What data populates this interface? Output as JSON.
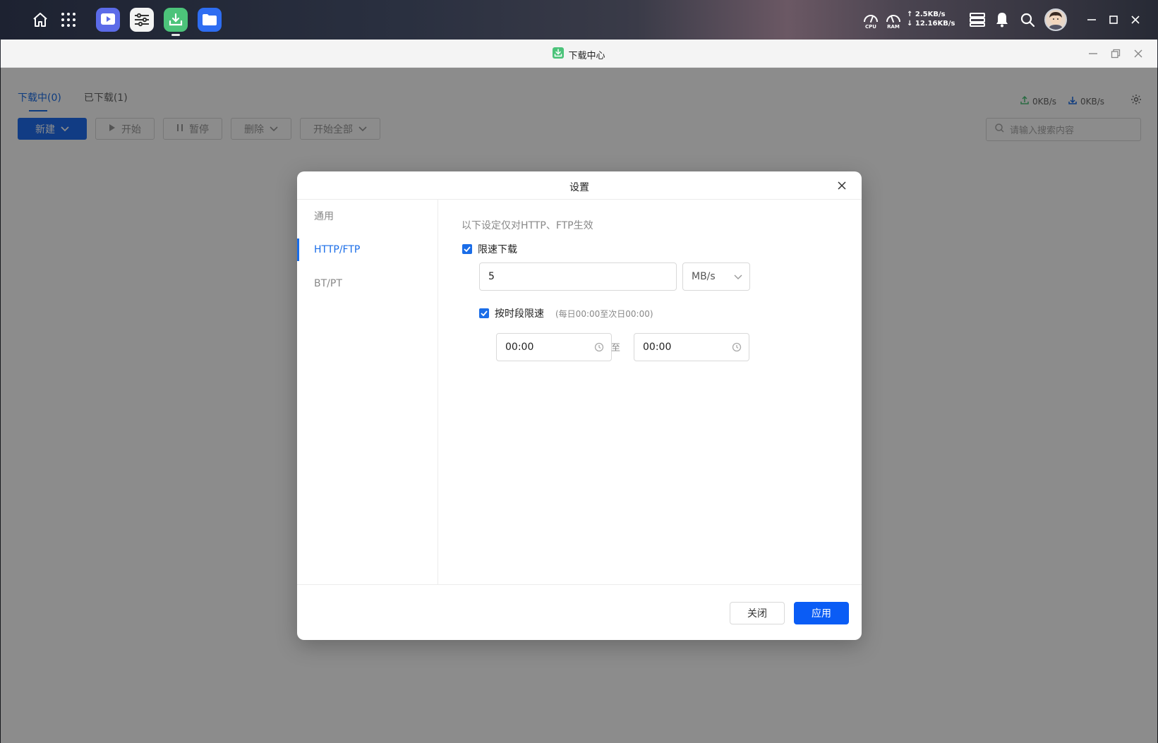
{
  "system_bar": {
    "cpu_label": "CPU",
    "ram_label": "RAM",
    "upload_speed": "↑ 2.5KB/s",
    "download_speed": "↓ 12.16KB/s"
  },
  "window": {
    "title": "下载中心"
  },
  "tabs": [
    {
      "label": "下载中(0)",
      "active": true
    },
    {
      "label": "已下载(1)",
      "active": false
    }
  ],
  "speed": {
    "upload": "0KB/s",
    "download": "0KB/s"
  },
  "toolbar": {
    "new_label": "新建",
    "start_label": "开始",
    "pause_label": "暂停",
    "delete_label": "删除",
    "start_all_label": "开始全部"
  },
  "search": {
    "placeholder": "请输入搜索内容"
  },
  "dialog": {
    "title": "设置",
    "sidebar": [
      {
        "label": "通用",
        "active": false
      },
      {
        "label": "HTTP/FTP",
        "active": true
      },
      {
        "label": "BT/PT",
        "active": false
      }
    ],
    "note": "以下设定仅对HTTP、FTP生效",
    "limit_download": {
      "label": "限速下载",
      "checked": true,
      "value": "5",
      "unit": "MB/s"
    },
    "schedule": {
      "label": "按时段限速",
      "hint": "(每日00:00至次日00:00)",
      "checked": true,
      "start": "00:00",
      "to_label": "至",
      "end": "00:00"
    },
    "buttons": {
      "close": "关闭",
      "apply": "应用"
    }
  },
  "colors": {
    "accent": "#1a6de8",
    "apply_button": "#0a5cf5",
    "download_app_green": "#4cc37a"
  }
}
